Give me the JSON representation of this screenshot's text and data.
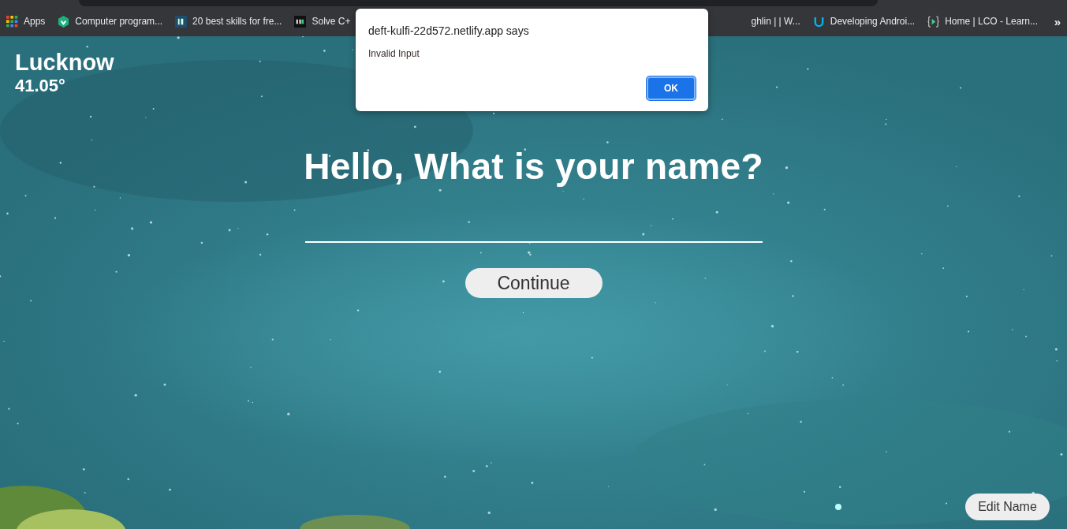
{
  "browser": {
    "bookmarks": [
      {
        "label": "Apps"
      },
      {
        "label": "Computer program..."
      },
      {
        "label": "20 best skills for fre..."
      },
      {
        "label": "Solve C+"
      },
      {
        "label": "ghlin | | W..."
      },
      {
        "label": "Developing Androi..."
      },
      {
        "label": "Home | LCO - Learn..."
      }
    ],
    "overflow": "»"
  },
  "dialog": {
    "title": "deft-kulfi-22d572.netlify.app says",
    "message": "Invalid Input",
    "button": "OK"
  },
  "weather": {
    "city": "Lucknow",
    "temperature": "41.05°"
  },
  "prompt": {
    "heading": "Hello, What is your name?",
    "button": "Continue"
  },
  "edit_button": "Edit Name"
}
